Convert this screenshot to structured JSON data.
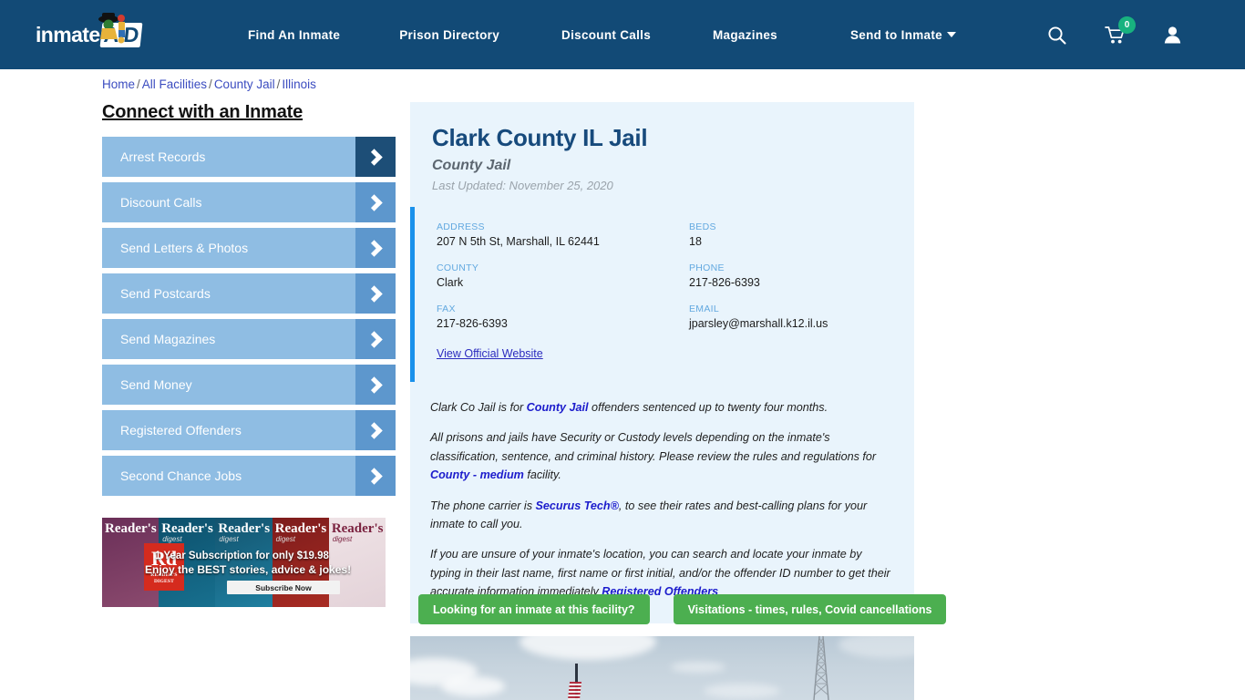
{
  "header": {
    "logo_text": "inmate",
    "logo_accent": "AID",
    "logo_icon": "mascot-icon",
    "nav": [
      {
        "label": "Find An Inmate"
      },
      {
        "label": "Prison Directory"
      },
      {
        "label": "Discount Calls"
      },
      {
        "label": "Magazines"
      },
      {
        "label": "Send to Inmate",
        "has_dropdown": true
      }
    ],
    "icons": {
      "search": "search-icon",
      "cart": "cart-icon",
      "account": "user-account-icon"
    },
    "cart_count": "0",
    "bg_color": "#124a76",
    "cart_badge_color": "#18b27f"
  },
  "breadcrumb": {
    "items": [
      "Home",
      "All Facilities",
      "County Jail",
      "Illinois"
    ],
    "separator": "/"
  },
  "sidebar": {
    "title": "Connect with an Inmate",
    "items": [
      {
        "label": "Arrest Records",
        "active": true
      },
      {
        "label": "Discount Calls",
        "active": false
      },
      {
        "label": "Send Letters & Photos",
        "active": false
      },
      {
        "label": "Send Postcards",
        "active": false
      },
      {
        "label": "Send Magazines",
        "active": false
      },
      {
        "label": "Send Money",
        "active": false
      },
      {
        "label": "Registered Offenders",
        "active": false
      },
      {
        "label": "Second Chance Jobs",
        "active": false
      }
    ],
    "ad": {
      "brand": "Reader's",
      "brand_sub": "digest",
      "logo_mark": "Rd",
      "logo_label": "READER'S DIGEST",
      "line1": "1 Year Subscription for only $19.98",
      "line2": "Enjoy the BEST stories, advice & jokes!",
      "cta": "Subscribe Now"
    }
  },
  "facility": {
    "name": "Clark County IL Jail",
    "type": "County Jail",
    "last_updated": "Last Updated: November 25, 2020",
    "fields": [
      {
        "label": "ADDRESS",
        "value": "207 N 5th St, Marshall, IL 62441"
      },
      {
        "label": "BEDS",
        "value": "18"
      },
      {
        "label": "COUNTY",
        "value": "Clark"
      },
      {
        "label": "PHONE",
        "value": "217-826-6393"
      },
      {
        "label": "FAX",
        "value": "217-826-6393"
      },
      {
        "label": "EMAIL",
        "value": "jparsley@marshall.k12.il.us"
      }
    ],
    "official_website_link": "View Official Website",
    "accent_color": "#1a91eb",
    "card_bg": "#e9f4fc"
  },
  "description": {
    "p1_a": "Clark Co Jail is for ",
    "p1_link": "County Jail",
    "p1_b": " offenders sentenced up to twenty four months.",
    "p2_a": "All prisons and jails have Security or Custody levels depending on the inmate's classification, sentence, and criminal history. Please review the rules and regulations for ",
    "p2_link": "County - medium",
    "p2_b": " facility.",
    "p3_a": "The phone carrier is ",
    "p3_link": "Securus Tech®",
    "p3_b": ", to see their rates and best-calling plans for your inmate to call you.",
    "p4_a": "If you are unsure of your inmate's location, you can search and locate your inmate by typing in their last name, first name or first initial, and/or the offender ID number to get their accurate information immediately ",
    "p4_link": "Registered Offenders",
    "p4_b": ""
  },
  "actions": {
    "inmate_search": "Looking for an inmate at this facility?",
    "visitations": "Visitations - times, rules, Covid cancellations",
    "button_color": "#4caf50"
  },
  "photo": {
    "caption": "facility-exterior-photo-sky-flagpole-radio-tower"
  }
}
